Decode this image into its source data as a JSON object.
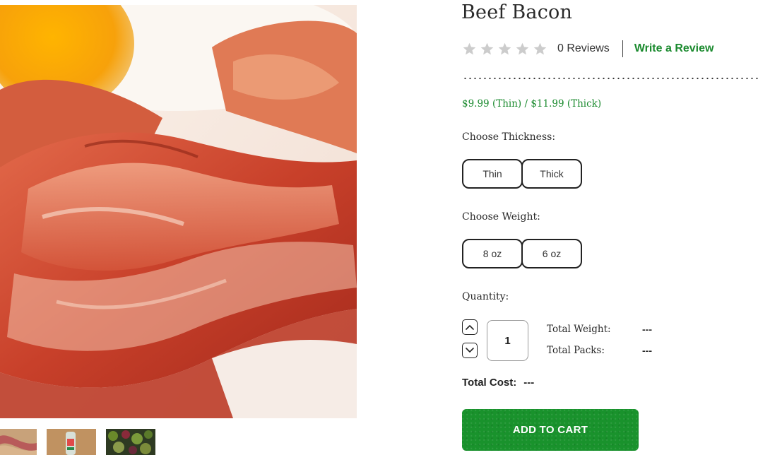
{
  "product": {
    "title": "Beef Bacon",
    "price_text": "$9.99 (Thin) / $11.99 (Thick)"
  },
  "rating": {
    "stars_filled": 0,
    "stars_total": 5,
    "reviews_text": "0 Reviews",
    "write_review_label": "Write a Review",
    "star_color": "#cccccc"
  },
  "options": {
    "thickness_label": "Choose Thickness:",
    "thickness_choices": [
      "Thin",
      "Thick"
    ],
    "weight_label": "Choose Weight:",
    "weight_choices": [
      "8 oz",
      "6 oz"
    ]
  },
  "quantity": {
    "label": "Quantity:",
    "value": "1",
    "up_icon": "chevron-up-icon",
    "down_icon": "chevron-down-icon"
  },
  "summary": {
    "total_weight_label": "Total Weight:",
    "total_weight_value": "---",
    "total_packs_label": "Total Packs:",
    "total_packs_value": "---",
    "total_cost_label": "Total Cost:",
    "total_cost_value": "---"
  },
  "cart": {
    "add_to_cart_label": "ADD TO CART"
  },
  "colors": {
    "accent_green": "#1a8a2e",
    "button_green": "#19922c",
    "text_dark": "#2a2a2a"
  }
}
